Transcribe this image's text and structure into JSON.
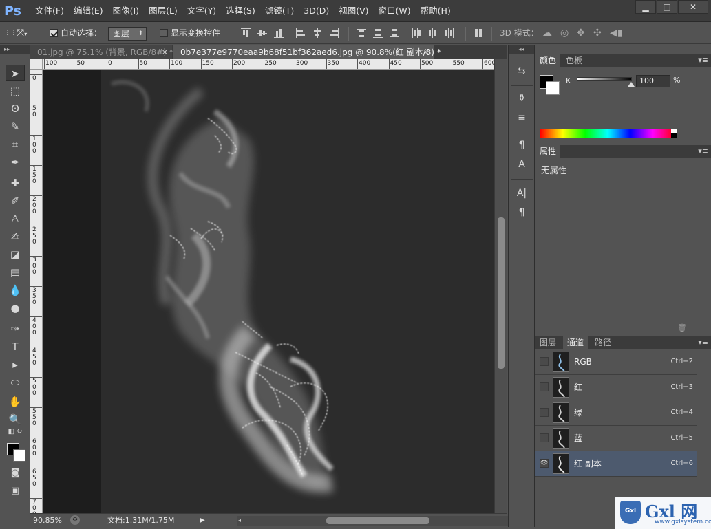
{
  "app": {
    "logo": "Ps"
  },
  "menu": [
    "文件(F)",
    "编辑(E)",
    "图像(I)",
    "图层(L)",
    "文字(Y)",
    "选择(S)",
    "滤镜(T)",
    "3D(D)",
    "视图(V)",
    "窗口(W)",
    "帮助(H)"
  ],
  "window_controls": {
    "minimize": "▁",
    "maximize": "□",
    "close": "✕"
  },
  "options": {
    "auto_select_label": "自动选择：",
    "auto_select_checked": true,
    "auto_select_target": "图层",
    "transform_controls_label": "显示变换控件",
    "transform_controls_checked": false,
    "mode_3d_label": "3D 模式："
  },
  "tabs": [
    {
      "title": "01.jpg @ 75.1% (背景, RGB/8#) *",
      "close": "×",
      "active": false
    },
    {
      "title": "0b7e377e9770eaa9b68f51bf362aed6.jpg @ 90.8%(红 副本/8) *",
      "close": "×",
      "active": true
    }
  ],
  "ruler": {
    "top": [
      "100",
      "50",
      "0",
      "50",
      "100",
      "150",
      "200",
      "250",
      "300",
      "350",
      "400",
      "450",
      "500",
      "550",
      "600"
    ],
    "left": [
      "0",
      "5 0",
      "1 0 0",
      "1 5 0",
      "2 0 0",
      "2 5 0",
      "3 0 0",
      "3 5 0",
      "4 0 0",
      "4 5 0",
      "5 0 0",
      "5 5 0",
      "6 0 0",
      "6 5 0",
      "7 0 0"
    ]
  },
  "status": {
    "zoom": "90.85%",
    "doc": "文档:1.31M/1.75M"
  },
  "color_panel": {
    "tabs": [
      "颜色",
      "色板"
    ],
    "channel_label": "K",
    "value": "100",
    "unit": "%",
    "fg": "#000000",
    "bg": "#ffffff"
  },
  "properties_panel": {
    "tab": "属性",
    "content": "无属性"
  },
  "channels_panel": {
    "tabs": [
      "图层",
      "通道",
      "路径"
    ],
    "rows": [
      {
        "name": "RGB",
        "shortcut": "Ctrl+2",
        "visible": false,
        "selected": false
      },
      {
        "name": "红",
        "shortcut": "Ctrl+3",
        "visible": false,
        "selected": false
      },
      {
        "name": "绿",
        "shortcut": "Ctrl+4",
        "visible": false,
        "selected": false
      },
      {
        "name": "蓝",
        "shortcut": "Ctrl+5",
        "visible": false,
        "selected": false
      },
      {
        "name": "红 副本",
        "shortcut": "Ctrl+6",
        "visible": true,
        "selected": true
      }
    ]
  },
  "watermark": {
    "brand": "Gxl 网",
    "site": "www.gxlsystem.com",
    "badge": "Gxl"
  }
}
